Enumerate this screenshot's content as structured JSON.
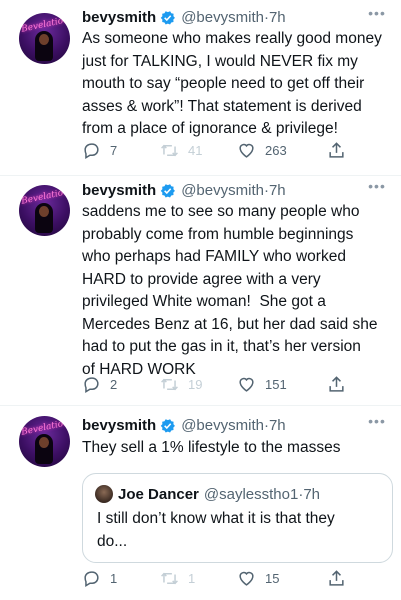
{
  "tweets": [
    {
      "name": "bevysmith",
      "handle": "@bevysmith",
      "time": "7h",
      "text": "As someone who makes really good money\njust for TALKING, I would NEVER fix my\nmouth to say “people need to get off their\nasses & work”! That statement is derived\nfrom a place of ignorance & privilege!",
      "replies": "7",
      "retweets": "41",
      "likes": "263"
    },
    {
      "name": "bevysmith",
      "handle": "@bevysmith",
      "time": "7h",
      "text": "saddens me to see so many people who\nprobably come from humble beginnings\nwho perhaps had FAMILY who worked\nHARD to provide agree with a very\nprivileged White woman!  She got a\nMercedes Benz at 16, but her dad said she\nhad to put the gas in it, that’s her version\nof HARD WORK",
      "replies": "2",
      "retweets": "19",
      "likes": "151"
    },
    {
      "name": "bevysmith",
      "handle": "@bevysmith",
      "time": "7h",
      "text": "They sell a 1% lifestyle to the masses",
      "replies": "1",
      "retweets": "1",
      "likes": "15",
      "quote": {
        "name": "Joe Dancer",
        "handle": "@saylesstho1",
        "time": "7h",
        "text": "I still don’t know what it is that they\ndo..."
      }
    }
  ],
  "avatar_text": "Bevelations",
  "colors": {
    "verified": "#1d9bf0",
    "secondary_text": "#536471",
    "border": "#eff3f4"
  }
}
